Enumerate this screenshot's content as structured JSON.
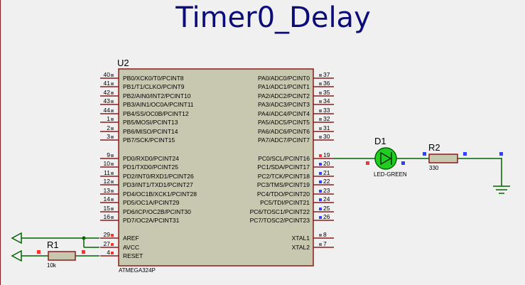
{
  "title": "Timer0_Delay",
  "chip": {
    "ref": "U2",
    "part": "ATMEGA324P",
    "left_pins": [
      {
        "num": "40",
        "name": "PB0/XCK0/T0/PCINT8"
      },
      {
        "num": "41",
        "name": "PB1/T1/CLKO/PCINT9"
      },
      {
        "num": "42",
        "name": "PB2/AIN0/INT2/PCINT10"
      },
      {
        "num": "43",
        "name": "PB3/AIN1/OC0A/PCINT11"
      },
      {
        "num": "44",
        "name": "PB4/SS/OC0B/PCINT12"
      },
      {
        "num": "1",
        "name": "PB5/MOSI/PCINT13"
      },
      {
        "num": "2",
        "name": "PB6/MISO/PCINT14"
      },
      {
        "num": "3",
        "name": "PB7/SCK/PCINT15"
      },
      {
        "num": "9",
        "name": "PD0/RXD0/PCINT24"
      },
      {
        "num": "10",
        "name": "PD1/TXD0/PCINT25"
      },
      {
        "num": "11",
        "name": "PD2/INT0/RXD1/PCINT26"
      },
      {
        "num": "12",
        "name": "PD3/INT1/TXD1/PCINT27"
      },
      {
        "num": "13",
        "name": "PD4/OC1B/XCK1/PCINT28"
      },
      {
        "num": "14",
        "name": "PD5/OC1A/PCINT29"
      },
      {
        "num": "15",
        "name": "PD6/ICP/OC2B/PCINT30"
      },
      {
        "num": "16",
        "name": "PD7/OC2A/PCINT31"
      },
      {
        "num": "29",
        "name": "AREF"
      },
      {
        "num": "27",
        "name": "AVCC"
      },
      {
        "num": "4",
        "name": "RESET"
      }
    ],
    "right_pins": [
      {
        "num": "37",
        "name": "PA0/ADC0/PCINT0"
      },
      {
        "num": "36",
        "name": "PA1/ADC1/PCINT1"
      },
      {
        "num": "35",
        "name": "PA2/ADC2/PCINT2"
      },
      {
        "num": "34",
        "name": "PA3/ADC3/PCINT3"
      },
      {
        "num": "33",
        "name": "PA4/ADC4/PCINT4"
      },
      {
        "num": "32",
        "name": "PA5/ADC5/PCINT5"
      },
      {
        "num": "31",
        "name": "PA6/ADC6/PCINT6"
      },
      {
        "num": "30",
        "name": "PA7/ADC7/PCINT7"
      },
      {
        "num": "19",
        "name": "PC0/SCL/PCINT16"
      },
      {
        "num": "20",
        "name": "PC1/SDA/PCINT17"
      },
      {
        "num": "21",
        "name": "PC2/TCK/PCINT18"
      },
      {
        "num": "22",
        "name": "PC3/TMS/PCINT19"
      },
      {
        "num": "23",
        "name": "PC4/TDO/PCINT20"
      },
      {
        "num": "24",
        "name": "PC5/TDI/PCINT21"
      },
      {
        "num": "25",
        "name": "PC6/TOSC1/PCINT22"
      },
      {
        "num": "26",
        "name": "PC7/TOSC2/PCINT23"
      },
      {
        "num": "8",
        "name": "XTAL1"
      },
      {
        "num": "7",
        "name": "XTAL2"
      }
    ]
  },
  "led": {
    "ref": "D1",
    "value": "LED-GREEN"
  },
  "r1": {
    "ref": "R1",
    "value": "10k"
  },
  "r2": {
    "ref": "R2",
    "value": "330"
  },
  "colors": {
    "background": "#f0f0f0",
    "body_fill": "#c8c8b0",
    "outline": "#8b1a1a",
    "wire": "#006400",
    "title": "#0b0b7a",
    "led_green": "#22cc22",
    "pin_square": "#808080",
    "blue_marker": "#3040ff",
    "red_marker": "#ff3030"
  }
}
